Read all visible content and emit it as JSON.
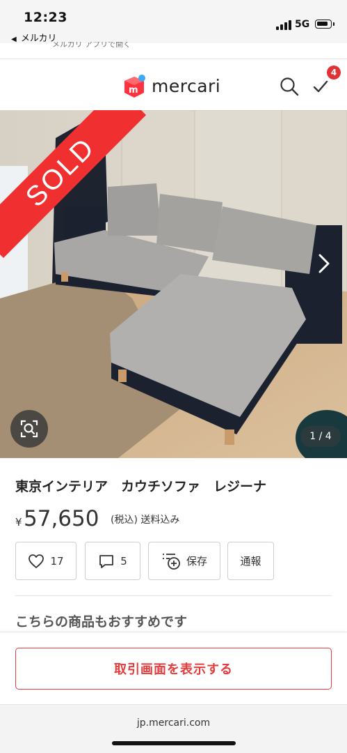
{
  "status_bar": {
    "time": "12:23",
    "back_app": "メルカリ",
    "network": "5G",
    "ghost_text": "メルカリ アプリで開く"
  },
  "header": {
    "logo_text": "mercari",
    "todo_count": "4",
    "brand_color": "#ff333f"
  },
  "photo": {
    "sold_label": "SOLD",
    "counter": "1 / 4"
  },
  "item": {
    "title": "東京インテリア　カウチソファ　レジーナ",
    "currency": "¥",
    "price": "57,650",
    "tax_note": "(税込) 送料込み"
  },
  "actions": {
    "like_count": "17",
    "comment_count": "5",
    "save_label": "保存",
    "report_label": "通報"
  },
  "recommend_heading": "こちらの商品もおすすめです",
  "cta": {
    "label": "取引画面を表示する",
    "color": "#e63b3b"
  },
  "browser": {
    "url": "jp.mercari.com"
  }
}
